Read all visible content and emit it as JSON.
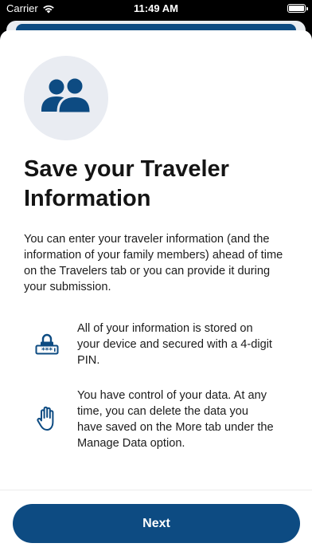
{
  "status_bar": {
    "carrier": "Carrier",
    "time": "11:49 AM",
    "icons": [
      "wifi-icon",
      "battery-icon"
    ]
  },
  "colors": {
    "primary": "#0d4b82",
    "hero_circle": "#e9ecf2",
    "text": "#1c1c1c",
    "background": "#ffffff"
  },
  "onboarding": {
    "hero_icon": "people-icon",
    "title": "Save your Traveler Information",
    "intro": "You can enter your traveler information (and the information of your family members) ahead of time on the Travelers tab or you can provide it during your submission.",
    "features": [
      {
        "icon": "lock-pin-icon",
        "text": "All of your information is stored on your device and secured with a 4-digit PIN."
      },
      {
        "icon": "hand-stop-icon",
        "text": "You have control of your data. At any time, you can delete the data you have saved on the More tab under the Manage Data option."
      }
    ]
  },
  "footer": {
    "next_label": "Next"
  }
}
